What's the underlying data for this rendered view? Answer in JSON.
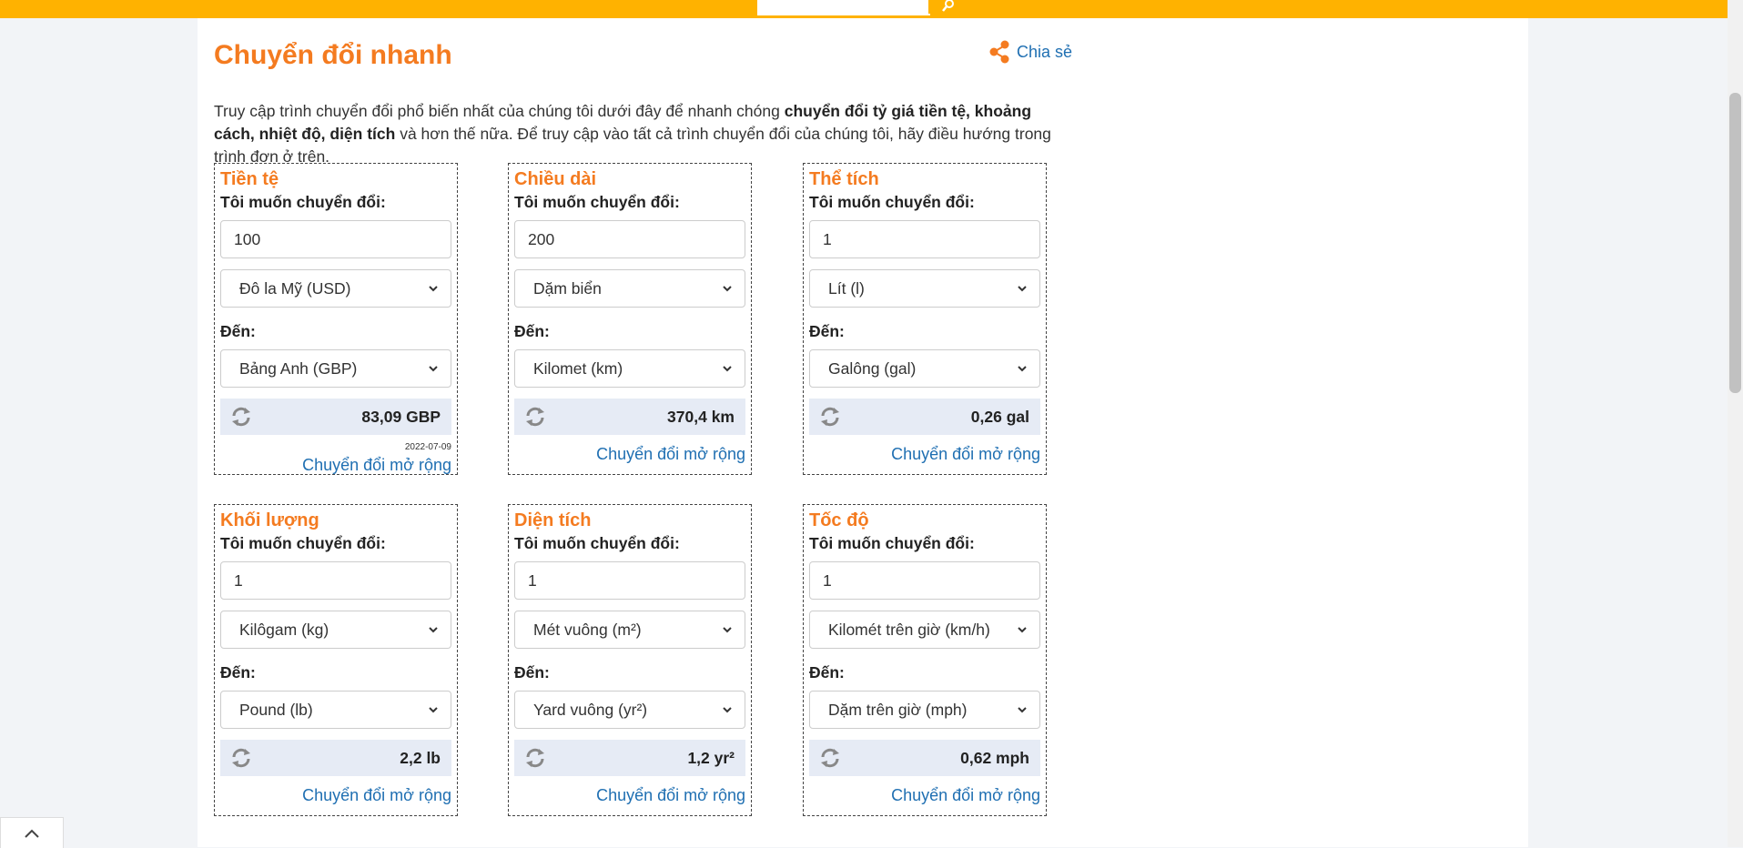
{
  "header": {
    "search_value": ""
  },
  "page": {
    "title": "Chuyển đổi nhanh",
    "share_label": "Chia sẻ",
    "intro": {
      "t1": "Truy cập trình chuyển đổi phổ biến nhất của chúng tôi dưới đây để nhanh chóng ",
      "b1": "chuyển đổi tỷ giá tiền tệ, khoảng cách, nhiệt độ, diện tích",
      "t2": " và hơn thế nữa. Để truy cập vào tất cả trình chuyển đổi của chúng tôi, hãy điều hướng trong trình đơn ở trên."
    }
  },
  "converters": [
    {
      "title": "Tiền tệ",
      "from_label": "Tôi muốn chuyển đổi:",
      "amount": "100",
      "from_unit": "Đô la Mỹ (USD)",
      "to_label": "Đến:",
      "to_unit": "Bảng Anh (GBP)",
      "result": "83,09 GBP",
      "date": "2022-07-09",
      "more_link": "Chuyển đổi mở rộng"
    },
    {
      "title": "Chiều dài",
      "from_label": "Tôi muốn chuyển đổi:",
      "amount": "200",
      "from_unit": "Dặm biển",
      "to_label": "Đến:",
      "to_unit": "Kilomet (km)",
      "result": "370,4 km",
      "more_link": "Chuyển đổi mở rộng"
    },
    {
      "title": "Thể tích",
      "from_label": "Tôi muốn chuyển đổi:",
      "amount": "1",
      "from_unit": "Lít (l)",
      "to_label": "Đến:",
      "to_unit": "Galông (gal)",
      "result": "0,26 gal",
      "more_link": "Chuyển đổi mở rộng"
    },
    {
      "title": "Khối lượng",
      "from_label": "Tôi muốn chuyển đổi:",
      "amount": "1",
      "from_unit": "Kilôgam (kg)",
      "to_label": "Đến:",
      "to_unit": "Pound (lb)",
      "result": "2,2 lb",
      "more_link": "Chuyển đổi mở rộng"
    },
    {
      "title": "Diện tích",
      "from_label": "Tôi muốn chuyển đổi:",
      "amount": "1",
      "from_unit": "Mét vuông (m²)",
      "to_label": "Đến:",
      "to_unit": "Yard vuông (yr²)",
      "result": "1,2 yr²",
      "more_link": "Chuyển đổi mở rộng"
    },
    {
      "title": "Tốc độ",
      "from_label": "Tôi muốn chuyển đổi:",
      "amount": "1",
      "from_unit": "Kilomét trên giờ (km/h)",
      "to_label": "Đến:",
      "to_unit": "Dặm trên giờ (mph)",
      "result": "0,62 mph",
      "more_link": "Chuyển đổi mở rộng"
    }
  ],
  "colors": {
    "accent": "#f47b20",
    "topbar": "#ffb200",
    "link": "#1f6fb2",
    "result_bg": "#e6ebf5"
  },
  "icons": {
    "share": "share-icon",
    "refresh": "refresh-icon",
    "chevron": "chevron-down-icon",
    "back_to_top": "chevron-up-icon",
    "search": "search-icon"
  }
}
